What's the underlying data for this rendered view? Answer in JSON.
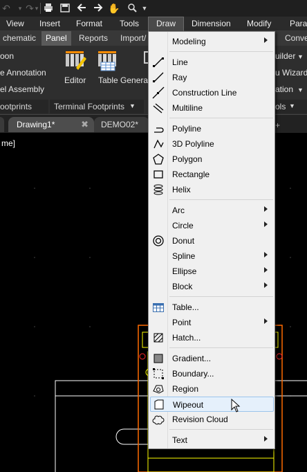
{
  "menubar": {
    "items": [
      "View",
      "Insert",
      "Format",
      "Tools",
      "Draw",
      "Dimension",
      "Modify",
      "Para"
    ]
  },
  "ribbon_tabs": [
    "chematic",
    "Panel",
    "Reports",
    "Import/",
    "Conve"
  ],
  "ribbon": {
    "left_items": [
      "oon",
      "e Annotation",
      "el Assembly"
    ],
    "editor_label": "Editor",
    "table_generator_label": "Table Generator",
    "footer_left": "ootprints",
    "footer_mid": "Terminal Footprints",
    "right_items": [
      "uilder",
      "u Wizard",
      "ation"
    ],
    "footer_right": "ols"
  },
  "doc_tabs": [
    "Drawing1*",
    "DEMO02*"
  ],
  "viewport_label": "me]",
  "draw_menu": {
    "items": [
      {
        "label": "Modeling",
        "icon": "none",
        "submenu": true
      },
      {
        "label": "Line",
        "icon": "line-icon",
        "submenu": false
      },
      {
        "label": "Ray",
        "icon": "ray-icon",
        "submenu": false
      },
      {
        "label": "Construction Line",
        "icon": "construction-line-icon",
        "submenu": false
      },
      {
        "label": "Multiline",
        "icon": "multiline-icon",
        "submenu": false
      },
      {
        "label": "Polyline",
        "icon": "polyline-icon",
        "submenu": false
      },
      {
        "label": "3D Polyline",
        "icon": "3d-polyline-icon",
        "submenu": false
      },
      {
        "label": "Polygon",
        "icon": "polygon-icon",
        "submenu": false
      },
      {
        "label": "Rectangle",
        "icon": "rectangle-icon",
        "submenu": false
      },
      {
        "label": "Helix",
        "icon": "helix-icon",
        "submenu": false
      },
      {
        "label": "Arc",
        "icon": "none",
        "submenu": true
      },
      {
        "label": "Circle",
        "icon": "none",
        "submenu": true
      },
      {
        "label": "Donut",
        "icon": "donut-icon",
        "submenu": false
      },
      {
        "label": "Spline",
        "icon": "none",
        "submenu": true
      },
      {
        "label": "Ellipse",
        "icon": "none",
        "submenu": true
      },
      {
        "label": "Block",
        "icon": "none",
        "submenu": true
      },
      {
        "label": "Table...",
        "icon": "table-icon",
        "submenu": false
      },
      {
        "label": "Point",
        "icon": "none",
        "submenu": true
      },
      {
        "label": "Hatch...",
        "icon": "hatch-icon",
        "submenu": false
      },
      {
        "label": "Gradient...",
        "icon": "gradient-icon",
        "submenu": false
      },
      {
        "label": "Boundary...",
        "icon": "boundary-icon",
        "submenu": false
      },
      {
        "label": "Region",
        "icon": "region-icon",
        "submenu": false
      },
      {
        "label": "Wipeout",
        "icon": "wipeout-icon",
        "submenu": false,
        "hovered": true
      },
      {
        "label": "Revision Cloud",
        "icon": "revision-cloud-icon",
        "submenu": false
      },
      {
        "label": "Text",
        "icon": "none",
        "submenu": true
      }
    ]
  },
  "colors": {
    "menu_bg": "#f0f0f0",
    "hover_bg": "#e5f0fb",
    "hover_border": "#9cc4ec",
    "canvas_bg": "#000000",
    "drawing_yellow": "#ffff00",
    "drawing_orange": "#ff6a00",
    "drawing_red": "#ff2a2a"
  }
}
